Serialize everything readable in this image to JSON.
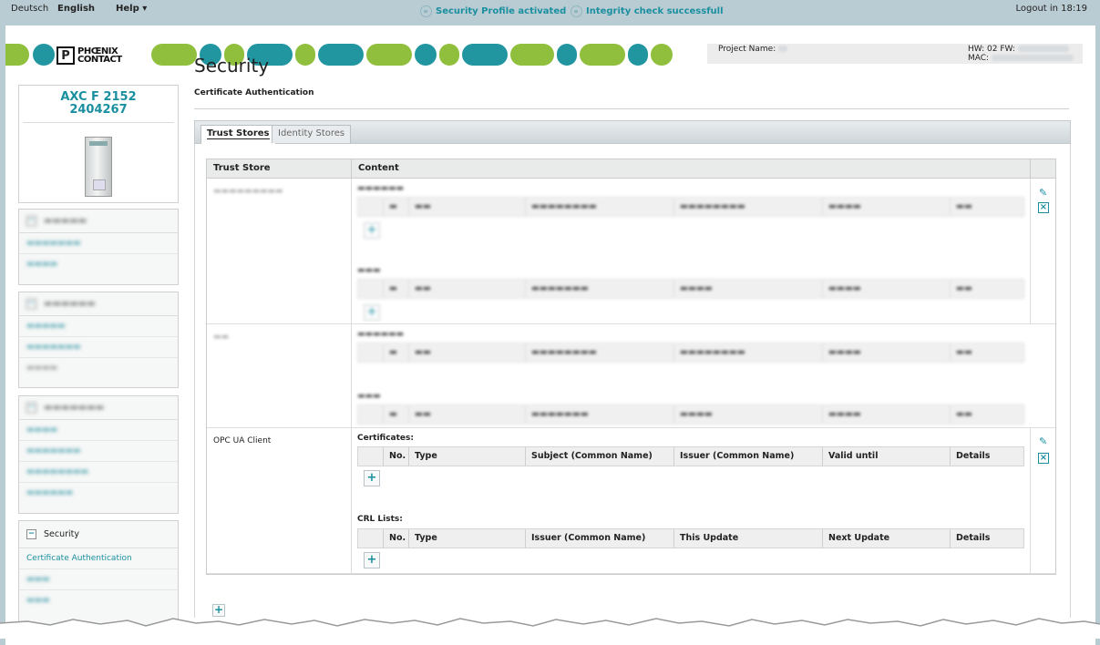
{
  "topbar": {
    "lang_de": "Deutsch",
    "lang_en": "English",
    "help": "Help ▾",
    "status1": "Security Profile activated",
    "status2": "Integrity check successfull",
    "logout": "Logout in 18:19"
  },
  "header": {
    "logo_line1": "PHŒNIX",
    "logo_line2": "CONTACT",
    "project_label": "Project Name:",
    "hw_label": "HW: 02 FW:",
    "mac_label": "MAC:"
  },
  "device": {
    "model": "AXC F 2152",
    "order_no": "2404267"
  },
  "nav": {
    "security_header": "Security",
    "security_item": "Certificate Authentication"
  },
  "page": {
    "title": "Security",
    "subtitle": "Certificate Authentication"
  },
  "tabs": {
    "trust_stores": "Trust Stores",
    "identity_stores": "Identity Stores"
  },
  "table": {
    "col_trust_store": "Trust Store",
    "col_content": "Content",
    "client_row_name": "OPC UA Client",
    "certificates_title": "Certificates:",
    "crl_title": "CRL Lists:",
    "cert_cols": [
      "No.",
      "Type",
      "Subject (Common Name)",
      "Issuer (Common Name)",
      "Valid until",
      "Details"
    ],
    "crl_cols": [
      "No.",
      "Type",
      "Issuer (Common Name)",
      "This Update",
      "Next Update",
      "Details"
    ]
  },
  "colors": {
    "brand_teal": "#2196a0",
    "brand_green": "#8fbf3c",
    "frame": "#b9ccd3"
  }
}
